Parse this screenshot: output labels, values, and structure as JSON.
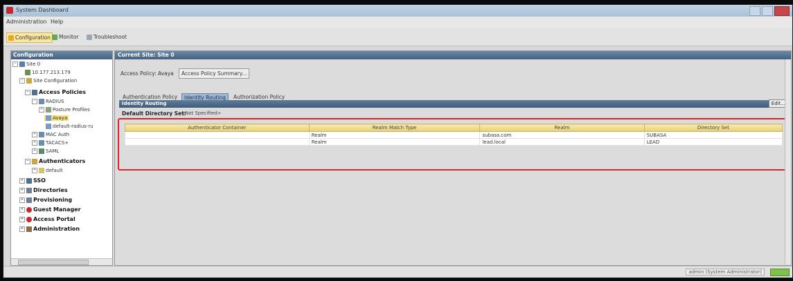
{
  "window": {
    "title": "System Dashboard"
  },
  "menu": {
    "items": [
      "Administration",
      "Help"
    ]
  },
  "toolbar": {
    "buttons": [
      "Configuration",
      "Monitor",
      "Troubleshoot"
    ]
  },
  "left_panel": {
    "title": "Configuration",
    "tree": [
      "Site 0",
      "10.177.213.179",
      "Site Configuration",
      "Access Policies",
      "RADIUS",
      "Posture Profiles",
      "Avaya",
      "default-radius-ru",
      "MAC Auth",
      "TACACS+",
      "SAML",
      "Authenticators",
      "default",
      "SSO",
      "Directories",
      "Provisioning",
      "Guest Manager",
      "Access Portal",
      "Administration"
    ]
  },
  "main": {
    "header": "Current Site: Site 0",
    "breadcrumb": [
      "Access Policy: Avaya",
      "Access Policy Summary..."
    ],
    "tabs": [
      "Authentication Policy",
      "Identity Routing",
      "Authorization Policy"
    ],
    "section_title": "Identity Routing",
    "edit_label": "Edit...",
    "default_directory_label": "Default Directory Set:",
    "default_directory_value": "<Not Specified>",
    "table": {
      "columns": [
        "Authenticator Container",
        "Realm Match Type",
        "Realm",
        "Directory Set"
      ],
      "rows": [
        [
          "",
          "Realm",
          "subasa.com",
          "SUBASA"
        ],
        [
          "",
          "Realm",
          "lead.local",
          "LEAD"
        ]
      ]
    }
  },
  "status": {
    "user": "admin (System Administrator)"
  },
  "colors": {
    "highlight": "#d8262c",
    "header": "#45617f",
    "selected": "#f6e07b"
  }
}
